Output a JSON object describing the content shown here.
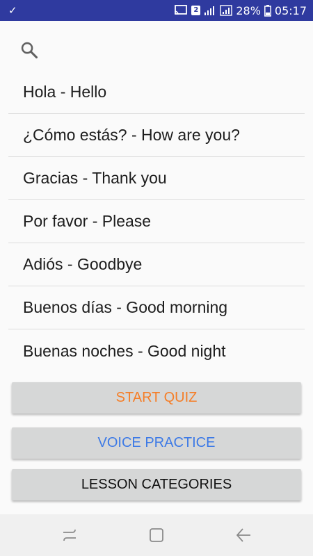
{
  "status_bar": {
    "check_icon": "check-icon",
    "sim_badge": "2",
    "battery": "28%",
    "time": "05:17"
  },
  "search": {
    "icon": "search-icon"
  },
  "phrases": [
    "Hola - Hello",
    "¿Cómo estás? - How are you?",
    "Gracias - Thank you",
    "Por favor - Please",
    "Adiós - Goodbye",
    "Buenos días - Good morning",
    "Buenas noches - Good night"
  ],
  "buttons": {
    "quiz": "START QUIZ",
    "voice": "VOICE PRACTICE",
    "lessons": "LESSON CATEGORIES"
  },
  "nav_bar": {
    "recent_icon": "recent-apps-icon",
    "home_icon": "home-icon",
    "back_icon": "back-icon"
  },
  "colors": {
    "status_bar": "#2f3a9f",
    "quiz_text": "#f57e28",
    "voice_text": "#3d7ae6",
    "button_bg": "#d6d7d7"
  }
}
